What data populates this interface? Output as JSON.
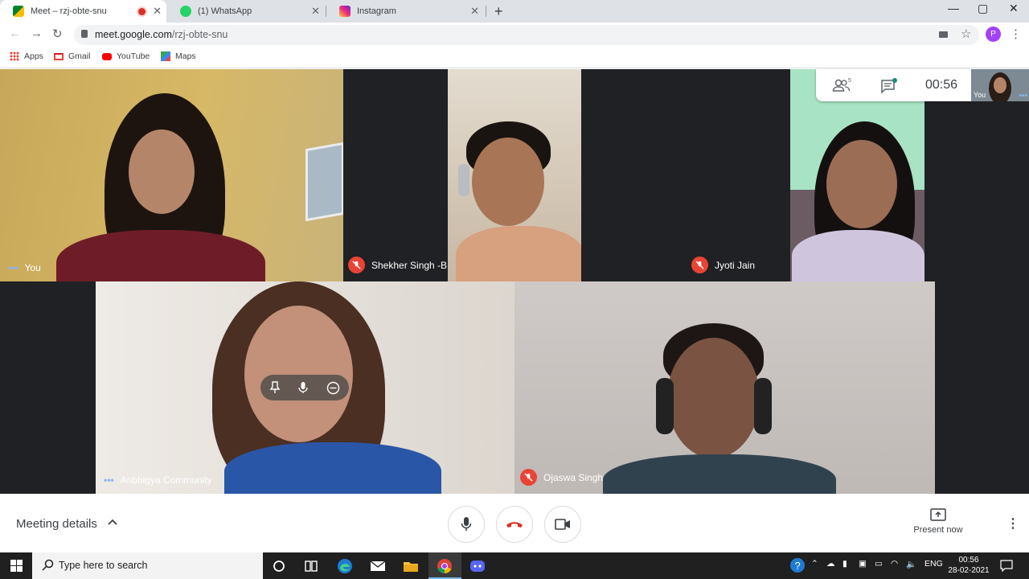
{
  "browser": {
    "tabs": [
      {
        "title": "Meet – rzj-obte-snu",
        "active": true,
        "recording": true
      },
      {
        "title": "(1) WhatsApp",
        "active": false
      },
      {
        "title": "Instagram",
        "active": false
      }
    ],
    "url_host": "meet.google.com",
    "url_path": "/rzj-obte-snu",
    "profile_initial": "P",
    "bookmarks": [
      "Apps",
      "Gmail",
      "YouTube",
      "Maps"
    ]
  },
  "meet": {
    "participants_count": "5",
    "elapsed": "00:56",
    "self_label": "You",
    "tiles": [
      {
        "name": "You",
        "muted": false
      },
      {
        "name": "Shekher Singh -B",
        "muted": true
      },
      {
        "name": "Jyoti Jain",
        "muted": true
      },
      {
        "name": "Anbhigya Community",
        "muted": false
      },
      {
        "name": "Ojaswa Singh",
        "muted": true
      }
    ],
    "meeting_details": "Meeting details",
    "present_now": "Present now"
  },
  "taskbar": {
    "search_placeholder": "Type here to search",
    "language": "ENG",
    "time": "00:56",
    "date": "28-02-2021"
  },
  "colors": {
    "accent": "#1a73e8",
    "danger": "#ea4335",
    "stage": "#202124"
  }
}
